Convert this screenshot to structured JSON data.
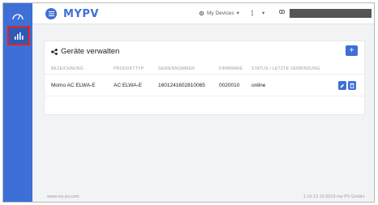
{
  "sidebar": {
    "items": [
      {
        "icon": "dashboard-icon"
      },
      {
        "icon": "bar-chart-icon"
      }
    ]
  },
  "header": {
    "logo": "MYPV",
    "devices_label": "My Devices",
    "language_label": "",
    "user_redacted": true
  },
  "devices_card": {
    "title": "Geräte verwalten",
    "add_label": "+",
    "columns": [
      "BEZEICHNUNG",
      "PRODUKTTYP",
      "SERIENNUMMER",
      "FIRMWARE",
      "STATUS / LETZTE VERBINDUNG"
    ],
    "rows": [
      {
        "name": "Momo AC ELWA-E",
        "product": "AC ELWA-E",
        "serial": "1601241602810065",
        "firmware": "0020010",
        "status": "online"
      }
    ]
  },
  "footer": {
    "left": "www.my-pv.com",
    "right": "1.19.12.10.2019 my-PV GmbH"
  },
  "colors": {
    "accent": "#3e6fd6",
    "highlight": "#e5231b"
  }
}
